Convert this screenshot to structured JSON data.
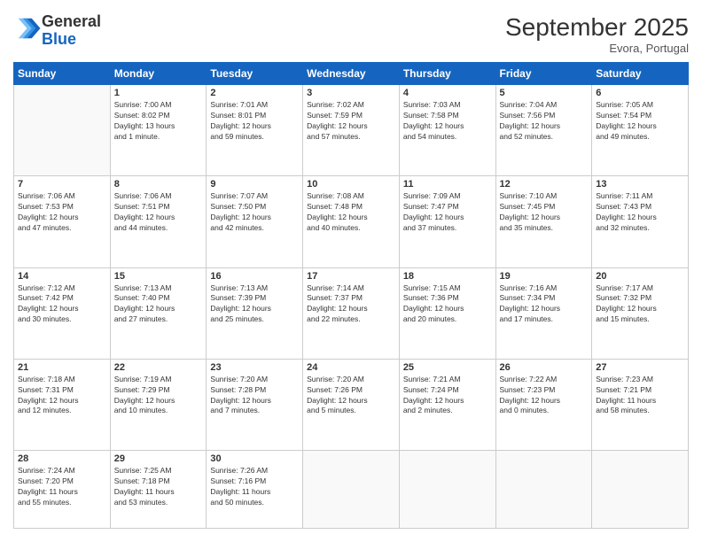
{
  "header": {
    "logo_general": "General",
    "logo_blue": "Blue",
    "month_title": "September 2025",
    "location": "Evora, Portugal"
  },
  "weekdays": [
    "Sunday",
    "Monday",
    "Tuesday",
    "Wednesday",
    "Thursday",
    "Friday",
    "Saturday"
  ],
  "weeks": [
    [
      {
        "day": "",
        "info": ""
      },
      {
        "day": "1",
        "info": "Sunrise: 7:00 AM\nSunset: 8:02 PM\nDaylight: 13 hours\nand 1 minute."
      },
      {
        "day": "2",
        "info": "Sunrise: 7:01 AM\nSunset: 8:01 PM\nDaylight: 12 hours\nand 59 minutes."
      },
      {
        "day": "3",
        "info": "Sunrise: 7:02 AM\nSunset: 7:59 PM\nDaylight: 12 hours\nand 57 minutes."
      },
      {
        "day": "4",
        "info": "Sunrise: 7:03 AM\nSunset: 7:58 PM\nDaylight: 12 hours\nand 54 minutes."
      },
      {
        "day": "5",
        "info": "Sunrise: 7:04 AM\nSunset: 7:56 PM\nDaylight: 12 hours\nand 52 minutes."
      },
      {
        "day": "6",
        "info": "Sunrise: 7:05 AM\nSunset: 7:54 PM\nDaylight: 12 hours\nand 49 minutes."
      }
    ],
    [
      {
        "day": "7",
        "info": "Sunrise: 7:06 AM\nSunset: 7:53 PM\nDaylight: 12 hours\nand 47 minutes."
      },
      {
        "day": "8",
        "info": "Sunrise: 7:06 AM\nSunset: 7:51 PM\nDaylight: 12 hours\nand 44 minutes."
      },
      {
        "day": "9",
        "info": "Sunrise: 7:07 AM\nSunset: 7:50 PM\nDaylight: 12 hours\nand 42 minutes."
      },
      {
        "day": "10",
        "info": "Sunrise: 7:08 AM\nSunset: 7:48 PM\nDaylight: 12 hours\nand 40 minutes."
      },
      {
        "day": "11",
        "info": "Sunrise: 7:09 AM\nSunset: 7:47 PM\nDaylight: 12 hours\nand 37 minutes."
      },
      {
        "day": "12",
        "info": "Sunrise: 7:10 AM\nSunset: 7:45 PM\nDaylight: 12 hours\nand 35 minutes."
      },
      {
        "day": "13",
        "info": "Sunrise: 7:11 AM\nSunset: 7:43 PM\nDaylight: 12 hours\nand 32 minutes."
      }
    ],
    [
      {
        "day": "14",
        "info": "Sunrise: 7:12 AM\nSunset: 7:42 PM\nDaylight: 12 hours\nand 30 minutes."
      },
      {
        "day": "15",
        "info": "Sunrise: 7:13 AM\nSunset: 7:40 PM\nDaylight: 12 hours\nand 27 minutes."
      },
      {
        "day": "16",
        "info": "Sunrise: 7:13 AM\nSunset: 7:39 PM\nDaylight: 12 hours\nand 25 minutes."
      },
      {
        "day": "17",
        "info": "Sunrise: 7:14 AM\nSunset: 7:37 PM\nDaylight: 12 hours\nand 22 minutes."
      },
      {
        "day": "18",
        "info": "Sunrise: 7:15 AM\nSunset: 7:36 PM\nDaylight: 12 hours\nand 20 minutes."
      },
      {
        "day": "19",
        "info": "Sunrise: 7:16 AM\nSunset: 7:34 PM\nDaylight: 12 hours\nand 17 minutes."
      },
      {
        "day": "20",
        "info": "Sunrise: 7:17 AM\nSunset: 7:32 PM\nDaylight: 12 hours\nand 15 minutes."
      }
    ],
    [
      {
        "day": "21",
        "info": "Sunrise: 7:18 AM\nSunset: 7:31 PM\nDaylight: 12 hours\nand 12 minutes."
      },
      {
        "day": "22",
        "info": "Sunrise: 7:19 AM\nSunset: 7:29 PM\nDaylight: 12 hours\nand 10 minutes."
      },
      {
        "day": "23",
        "info": "Sunrise: 7:20 AM\nSunset: 7:28 PM\nDaylight: 12 hours\nand 7 minutes."
      },
      {
        "day": "24",
        "info": "Sunrise: 7:20 AM\nSunset: 7:26 PM\nDaylight: 12 hours\nand 5 minutes."
      },
      {
        "day": "25",
        "info": "Sunrise: 7:21 AM\nSunset: 7:24 PM\nDaylight: 12 hours\nand 2 minutes."
      },
      {
        "day": "26",
        "info": "Sunrise: 7:22 AM\nSunset: 7:23 PM\nDaylight: 12 hours\nand 0 minutes."
      },
      {
        "day": "27",
        "info": "Sunrise: 7:23 AM\nSunset: 7:21 PM\nDaylight: 11 hours\nand 58 minutes."
      }
    ],
    [
      {
        "day": "28",
        "info": "Sunrise: 7:24 AM\nSunset: 7:20 PM\nDaylight: 11 hours\nand 55 minutes."
      },
      {
        "day": "29",
        "info": "Sunrise: 7:25 AM\nSunset: 7:18 PM\nDaylight: 11 hours\nand 53 minutes."
      },
      {
        "day": "30",
        "info": "Sunrise: 7:26 AM\nSunset: 7:16 PM\nDaylight: 11 hours\nand 50 minutes."
      },
      {
        "day": "",
        "info": ""
      },
      {
        "day": "",
        "info": ""
      },
      {
        "day": "",
        "info": ""
      },
      {
        "day": "",
        "info": ""
      }
    ]
  ]
}
